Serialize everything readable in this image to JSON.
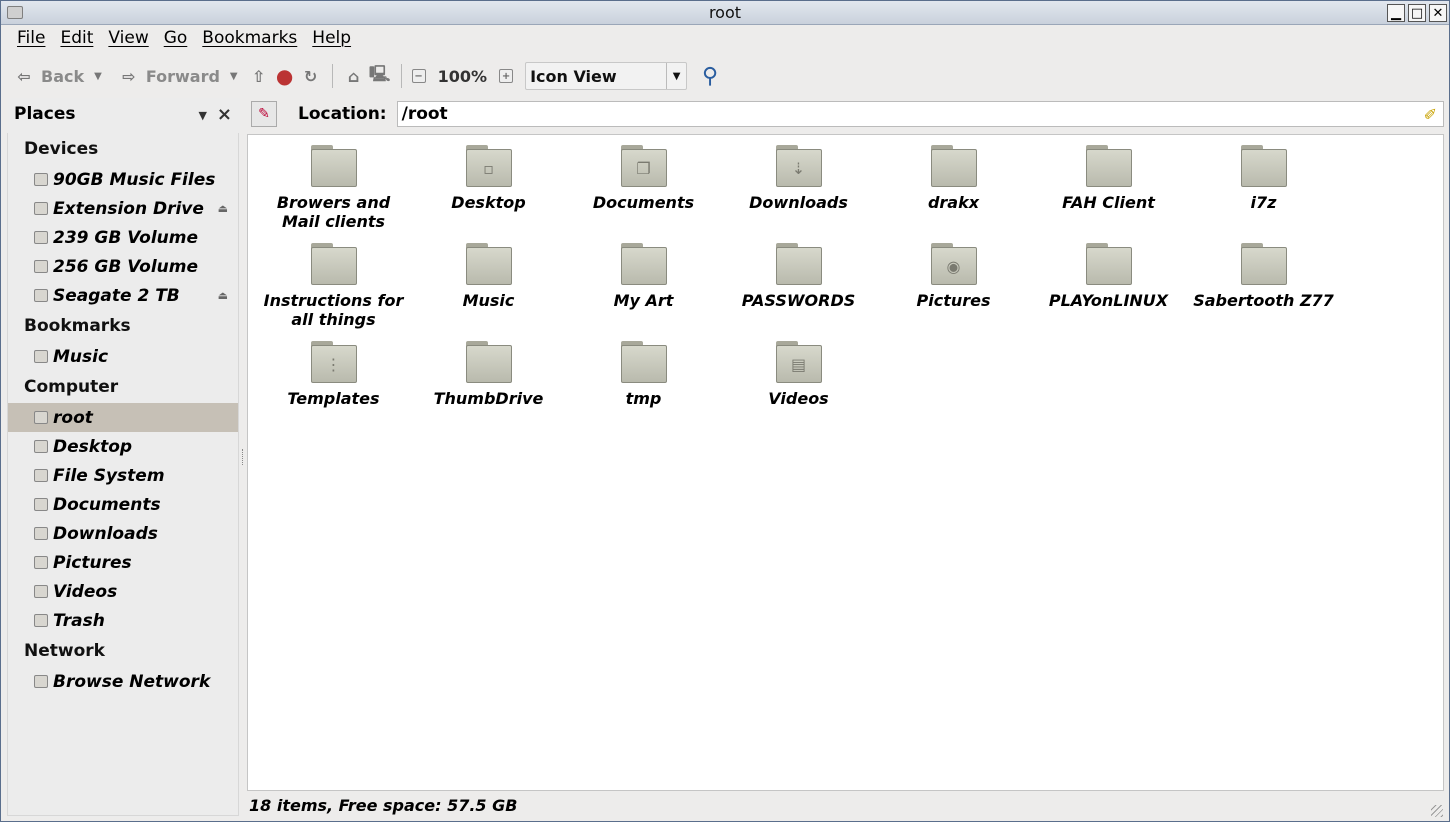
{
  "window": {
    "title": "root"
  },
  "menu": [
    "File",
    "Edit",
    "View",
    "Go",
    "Bookmarks",
    "Help"
  ],
  "toolbar": {
    "back_label": "Back",
    "forward_label": "Forward",
    "zoom_value": "100%",
    "view_mode": "Icon View"
  },
  "places": {
    "header": "Places",
    "sections": [
      {
        "title": "Devices",
        "items": [
          {
            "label": "90GB Music Files",
            "eject": false
          },
          {
            "label": "Extension Drive",
            "eject": true
          },
          {
            "label": "239 GB Volume",
            "eject": false
          },
          {
            "label": "256 GB Volume",
            "eject": false
          },
          {
            "label": "Seagate 2 TB",
            "eject": true
          }
        ]
      },
      {
        "title": "Bookmarks",
        "items": [
          {
            "label": "Music",
            "eject": false
          }
        ]
      },
      {
        "title": "Computer",
        "items": [
          {
            "label": "root",
            "selected": true
          },
          {
            "label": "Desktop"
          },
          {
            "label": "File System"
          },
          {
            "label": "Documents"
          },
          {
            "label": "Downloads"
          },
          {
            "label": "Pictures"
          },
          {
            "label": "Videos"
          },
          {
            "label": "Trash"
          }
        ]
      },
      {
        "title": "Network",
        "items": [
          {
            "label": "Browse Network"
          }
        ]
      }
    ]
  },
  "location": {
    "label": "Location:",
    "path": "/root"
  },
  "files": [
    {
      "name": "Browers and Mail clients",
      "emblem": ""
    },
    {
      "name": "Desktop",
      "emblem": "▫"
    },
    {
      "name": "Documents",
      "emblem": "❐"
    },
    {
      "name": "Downloads",
      "emblem": "⇣"
    },
    {
      "name": "drakx",
      "emblem": ""
    },
    {
      "name": "FAH Client",
      "emblem": ""
    },
    {
      "name": "i7z",
      "emblem": ""
    },
    {
      "name": "Instructions for all things",
      "emblem": ""
    },
    {
      "name": "Music",
      "emblem": ""
    },
    {
      "name": "My Art",
      "emblem": ""
    },
    {
      "name": "PASSWORDS",
      "emblem": ""
    },
    {
      "name": "Pictures",
      "emblem": "◉"
    },
    {
      "name": "PLAYonLINUX",
      "emblem": ""
    },
    {
      "name": "Sabertooth Z77",
      "emblem": ""
    },
    {
      "name": "Templates",
      "emblem": "⋮"
    },
    {
      "name": "ThumbDrive",
      "emblem": ""
    },
    {
      "name": "tmp",
      "emblem": ""
    },
    {
      "name": "Videos",
      "emblem": "▤"
    }
  ],
  "status": "18 items, Free space: 57.5 GB"
}
